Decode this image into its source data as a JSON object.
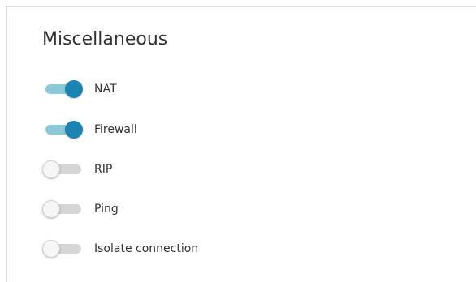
{
  "section": {
    "title": "Miscellaneous"
  },
  "toggles": [
    {
      "label": "NAT",
      "enabled": true
    },
    {
      "label": "Firewall",
      "enabled": true
    },
    {
      "label": "RIP",
      "enabled": false
    },
    {
      "label": "Ping",
      "enabled": false
    },
    {
      "label": "Isolate connection",
      "enabled": false
    }
  ],
  "colors": {
    "toggle_on_knob": "#1c84b0",
    "toggle_on_track": "#8cc8d8",
    "toggle_off_track": "#d6d6d6",
    "toggle_off_knob": "#f6f6f6",
    "text": "#333333"
  }
}
